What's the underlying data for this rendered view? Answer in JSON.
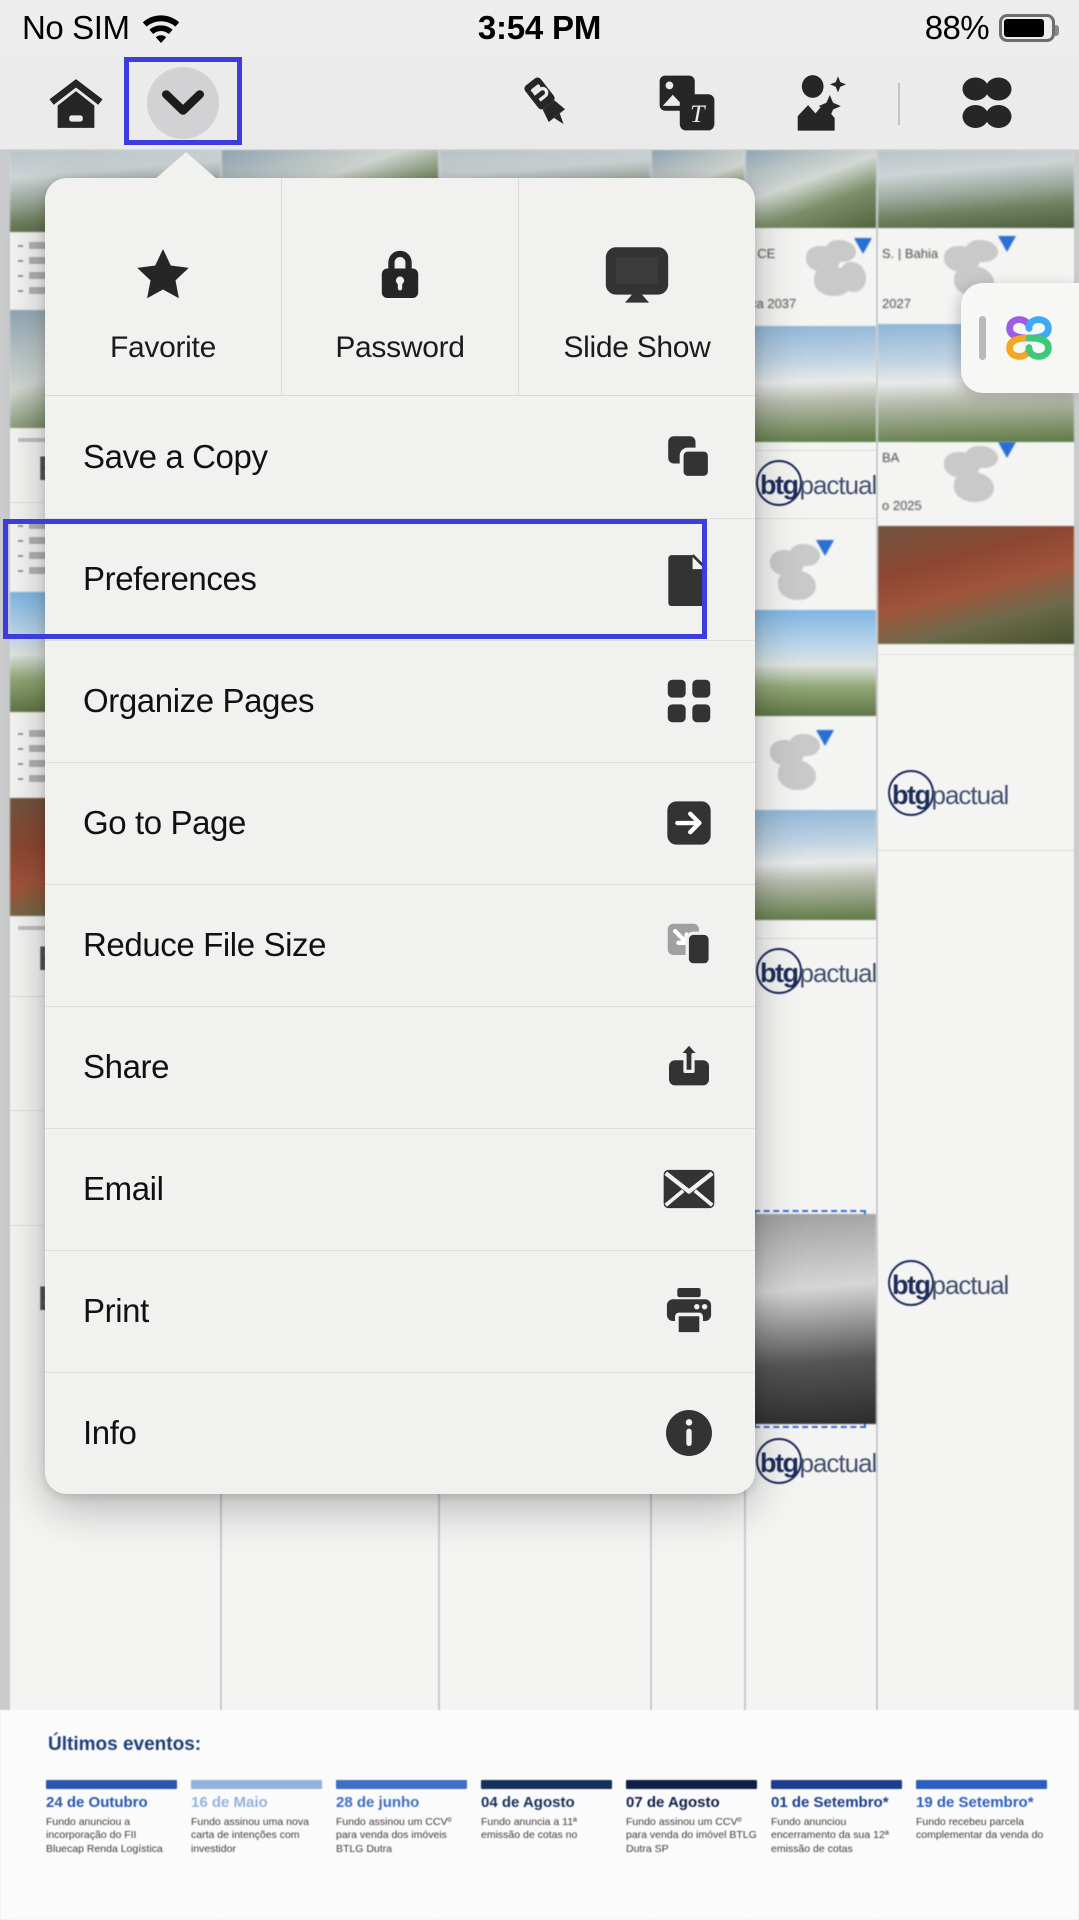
{
  "status_bar": {
    "carrier": "No SIM",
    "wifi_icon": "wifi-icon",
    "time": "3:54 PM",
    "battery_percent": "88%",
    "battery_icon": "battery-icon"
  },
  "toolbar": {
    "home_icon": "home-icon",
    "chevron_icon": "chevron-down-icon",
    "marker_icon": "highlighter-marker-icon",
    "image_text_icon": "image-text-icon",
    "ai_photo_icon": "ai-photo-icon",
    "grid_icon": "four-petal-grid-icon"
  },
  "dropdown_menu": {
    "quick_actions": [
      {
        "label": "Favorite",
        "icon": "star-icon"
      },
      {
        "label": "Password",
        "icon": "lock-icon"
      },
      {
        "label": "Slide Show",
        "icon": "presentation-screen-icon"
      }
    ],
    "items": [
      {
        "label": "Save a Copy",
        "icon": "copy-duplicate-icon"
      },
      {
        "label": "Preferences",
        "icon": "document-page-icon",
        "highlighted": true
      },
      {
        "label": "Organize Pages",
        "icon": "grid-four-squares-icon"
      },
      {
        "label": "Go to Page",
        "icon": "arrow-right-box-icon"
      },
      {
        "label": "Reduce File Size",
        "icon": "compress-icon"
      },
      {
        "label": "Share",
        "icon": "share-upload-icon"
      },
      {
        "label": "Email",
        "icon": "envelope-icon"
      },
      {
        "label": "Print",
        "icon": "printer-icon"
      },
      {
        "label": "Info",
        "icon": "info-circle-icon"
      }
    ]
  },
  "ai_widget": {
    "handle_icon": "drag-handle-icon",
    "logo_icon": "ai-clover-logo-icon"
  },
  "document": {
    "brand": {
      "bold": "btg",
      "light": "pactual"
    },
    "snippets": {
      "state_ce": ", CE",
      "year_2037": "ca 2037",
      "state_ba": "BA",
      "year_2027": "S. | Bahia",
      "year_2027b": "2027",
      "year_2025": "o 2025"
    },
    "timeline": {
      "title": "Últimos eventos:",
      "events": [
        {
          "date": "24 de Outubro",
          "text": "Fundo anunciou a incorporação do FII Bluecap Renda Logística",
          "accent": "#2a56b0"
        },
        {
          "date": "16 de Maio",
          "text": "Fundo assinou uma nova carta de intenções com investidor",
          "accent": "#93b3de"
        },
        {
          "date": "28 de junho",
          "text": "Fundo assinou um CCVº para venda dos imóveis BTLG Dutra",
          "accent": "#3f6fc4"
        },
        {
          "date": "04 de Agosto",
          "text": "Fundo anuncia a 11ª emissão de cotas no",
          "accent": "#16305e"
        },
        {
          "date": "07 de Agosto",
          "text": "Fundo assinou um CCVº para venda do imóvel BTLG Dutra SP",
          "accent": "#0f1f48"
        },
        {
          "date": "01 de Setembro*",
          "text": "Fundo anunciou encerramento da sua 12ª emissão de cotas",
          "accent": "#1b3d8c"
        },
        {
          "date": "19 de Setembro*",
          "text": "Fundo recebeu parcela complementar da venda do",
          "accent": "#2a5fc0"
        }
      ]
    }
  },
  "colors": {
    "highlight_blue": "#3d3ddb",
    "menu_background": "#f1f1f0",
    "toolbar_background": "#ebebec"
  }
}
